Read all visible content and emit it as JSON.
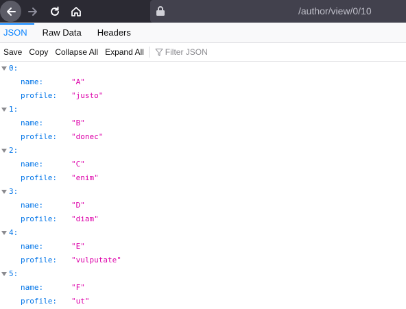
{
  "browser": {
    "url": "/author/view/0/10",
    "back_icon": "back-arrow-icon",
    "forward_icon": "forward-arrow-icon",
    "reload_icon": "reload-icon",
    "home_icon": "home-icon",
    "lock_icon": "lock-icon"
  },
  "tabs": [
    {
      "label": "JSON",
      "active": true
    },
    {
      "label": "Raw Data",
      "active": false
    },
    {
      "label": "Headers",
      "active": false
    }
  ],
  "toolbar": {
    "save": "Save",
    "copy": "Copy",
    "collapse_all": "Collapse All",
    "expand_all": "Expand All",
    "filter_placeholder": "Filter JSON"
  },
  "colors": {
    "accent": "#0a84ff",
    "key": "#0074e8",
    "string": "#dd00a9"
  },
  "entries": [
    {
      "index": "0:",
      "name": "\"A\"",
      "profile": "\"justo\""
    },
    {
      "index": "1:",
      "name": "\"B\"",
      "profile": "\"donec\""
    },
    {
      "index": "2:",
      "name": "\"C\"",
      "profile": "\"enim\""
    },
    {
      "index": "3:",
      "name": "\"D\"",
      "profile": "\"diam\""
    },
    {
      "index": "4:",
      "name": "\"E\"",
      "profile": "\"vulputate\""
    },
    {
      "index": "5:",
      "name": "\"F\"",
      "profile": "\"ut\""
    }
  ],
  "labels": {
    "name_key": "name:",
    "profile_key": "profile:"
  }
}
